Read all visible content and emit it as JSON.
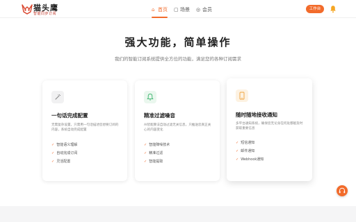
{
  "header": {
    "logo_title": "猫头鹰",
    "logo_subtitle": "智能同步订阅",
    "nav": [
      {
        "icon": "home-icon",
        "label": "首页",
        "active": true
      },
      {
        "icon": "chat-icon",
        "label": "场景",
        "active": false
      },
      {
        "icon": "member-icon",
        "label": "会员",
        "active": false
      }
    ],
    "workbench_label": "工作台"
  },
  "hero": {
    "title": "强大功能，简单操作",
    "subtitle": "我们的智能订阅系统提供全方位的功能，满足您的各种订阅需求"
  },
  "cards": [
    {
      "icon": "magic-wand-icon",
      "title": "一句话完成配置",
      "description": "无需复杂设置，只需用一句话描述您想要订阅的内容，系统自动完成配置",
      "features": [
        "智能语义理解",
        "自动完成订阅",
        "灵活配置"
      ]
    },
    {
      "icon": "bell-icon",
      "title": "精准过滤噪音",
      "description": "AI智能算法自动过滤无关信息，只推送您真正关心的内容变化",
      "features": [
        "智能降噪技术",
        "精准过滤",
        "智能提取"
      ]
    },
    {
      "icon": "phone-icon",
      "title": "随时随地接收通知",
      "description": "多平台通知系统，确保您无论身在何处都能及时获取重要信息",
      "features": [
        "短信通知",
        "邮件通知",
        "Webhook通知"
      ]
    }
  ],
  "colors": {
    "accent": "#f26b2b",
    "card1_icon_bg": "#f1f1f2",
    "card2_icon_bg": "#eaf7ee",
    "card3_icon_bg": "#fdf2e2",
    "footer_band": "#f5f5f6"
  }
}
